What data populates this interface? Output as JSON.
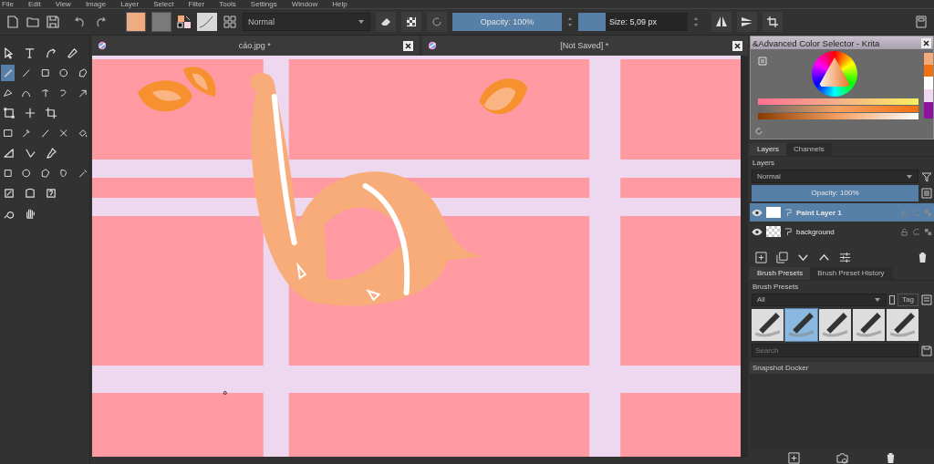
{
  "menu": [
    "File",
    "Edit",
    "View",
    "Image",
    "Layer",
    "Select",
    "Filter",
    "Tools",
    "Settings",
    "Window",
    "Help"
  ],
  "toolbar": {
    "blend_mode": "Normal",
    "opacity": {
      "label": "Opacity: 100%",
      "level": 1
    },
    "size": {
      "label": "Size: 5,09 px",
      "level": 0.25
    }
  },
  "tools": [
    [
      {
        "selected": false
      },
      {
        "selected": false
      },
      {
        "selected": false
      },
      {
        "selected": false
      }
    ],
    [
      {
        "selected": true
      },
      {
        "selected": false
      },
      {
        "selected": false
      },
      {
        "selected": false
      },
      {
        "selected": false
      }
    ],
    [
      {
        "selected": false
      },
      {
        "selected": false
      },
      {
        "selected": false
      },
      {
        "selected": false
      },
      {
        "selected": false
      }
    ],
    [
      {
        "selected": false
      },
      {
        "selected": false
      },
      {
        "selected": false
      }
    ],
    [
      {
        "selected": false
      },
      {
        "selected": false
      },
      {
        "selected": false
      },
      {
        "selected": false
      },
      {
        "selected": false
      }
    ],
    [
      {
        "selected": false
      },
      {
        "selected": false
      },
      {
        "selected": false
      }
    ],
    [
      {
        "selected": false
      },
      {
        "selected": false
      },
      {
        "selected": false
      },
      {
        "selected": false
      },
      {
        "selected": false
      }
    ],
    [
      {
        "selected": false
      },
      {
        "selected": false
      },
      {
        "selected": false
      }
    ],
    [
      {
        "selected": false
      },
      {
        "selected": false
      }
    ]
  ],
  "documents": [
    {
      "title": "cáo.jpg *"
    },
    {
      "title": "[Not Saved]  *"
    }
  ],
  "color_selector": {
    "title": "&Advanced Color Selector - Krita"
  },
  "layers_docker": {
    "tabs": [
      {
        "label": "Layers",
        "selected": true
      },
      {
        "label": "Channels",
        "selected": false
      }
    ],
    "title": "Layers",
    "blend_mode": "Normal",
    "opacity": {
      "label": "Opacity:  100%",
      "level": 1
    },
    "layers": [
      {
        "name": "Paint Layer 1",
        "selected": true,
        "visible": true
      },
      {
        "name": "background",
        "selected": false,
        "visible": true
      }
    ]
  },
  "brush_docker": {
    "tabs": [
      {
        "label": "Brush Presets",
        "selected": true
      },
      {
        "label": "Brush Preset History",
        "selected": false
      }
    ],
    "title": "Brush Presets",
    "filter": "All",
    "tag": "Tag",
    "presets": [
      {
        "selected": false
      },
      {
        "selected": true
      },
      {
        "selected": false
      },
      {
        "selected": false
      },
      {
        "selected": false
      }
    ],
    "search": {
      "placeholder": "Search"
    }
  },
  "snapshot_docker": {
    "title": "Snapshot Docker"
  }
}
